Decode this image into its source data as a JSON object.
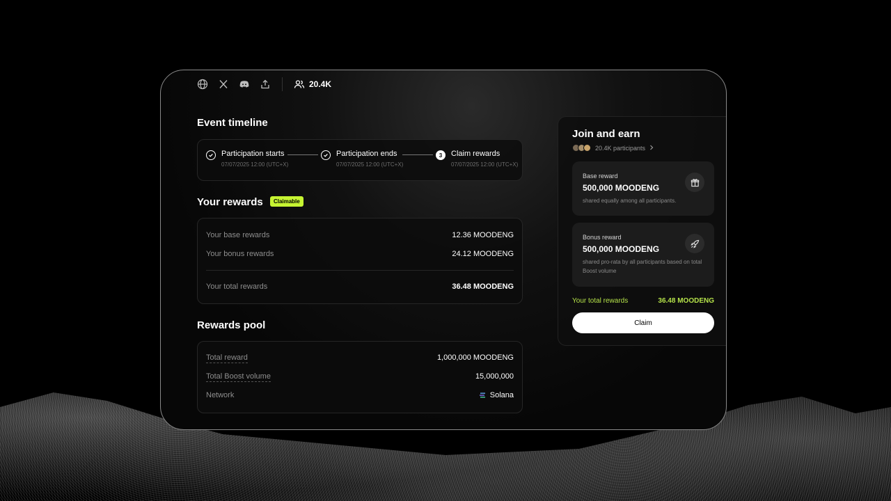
{
  "topbar": {
    "icons": [
      "globe-icon",
      "x-icon",
      "discord-icon",
      "share-icon"
    ],
    "members_count": "20.4K"
  },
  "timeline": {
    "title": "Event timeline",
    "steps": [
      {
        "label": "Participation starts",
        "date": "07/07/2025 12:00 (UTC+X)",
        "status": "done"
      },
      {
        "label": "Participation ends",
        "date": "07/07/2025 12:00 (UTC+X)",
        "status": "done"
      },
      {
        "label": "Claim rewards",
        "date": "07/07/2025 12:00 (UTC+X)",
        "status": "current",
        "number": "3"
      }
    ]
  },
  "your_rewards": {
    "title": "Your rewards",
    "badge": "Claimable",
    "rows": [
      {
        "label": "Your base rewards",
        "value": "12.36 MOODENG"
      },
      {
        "label": "Your bonus rewards",
        "value": "24.12 MOODENG"
      }
    ],
    "total": {
      "label": "Your total rewards",
      "value": "36.48 MOODENG"
    }
  },
  "rewards_pool": {
    "title": "Rewards pool",
    "rows": [
      {
        "label": "Total reward",
        "value": "1,000,000 MOODENG"
      },
      {
        "label": "Total Boost volume",
        "value": "15,000,000"
      },
      {
        "label": "Network",
        "value": "Solana"
      }
    ]
  },
  "join": {
    "title": "Join and earn",
    "participants": "20.4K participants",
    "base": {
      "title": "Base reward",
      "amount": "500,000 MOODENG",
      "desc": "shared equally among all participants."
    },
    "bonus": {
      "title": "Bonus reward",
      "amount": "500,000 MOODENG",
      "desc": "shared pro-rata by all participants based on total Boost volume"
    },
    "total_label": "Your total rewards",
    "total_value": "36.48 MOODENG",
    "claim_label": "Claim"
  },
  "colors": {
    "accent": "#c6f432",
    "total_green": "#b5e24a",
    "background": "#000000"
  }
}
